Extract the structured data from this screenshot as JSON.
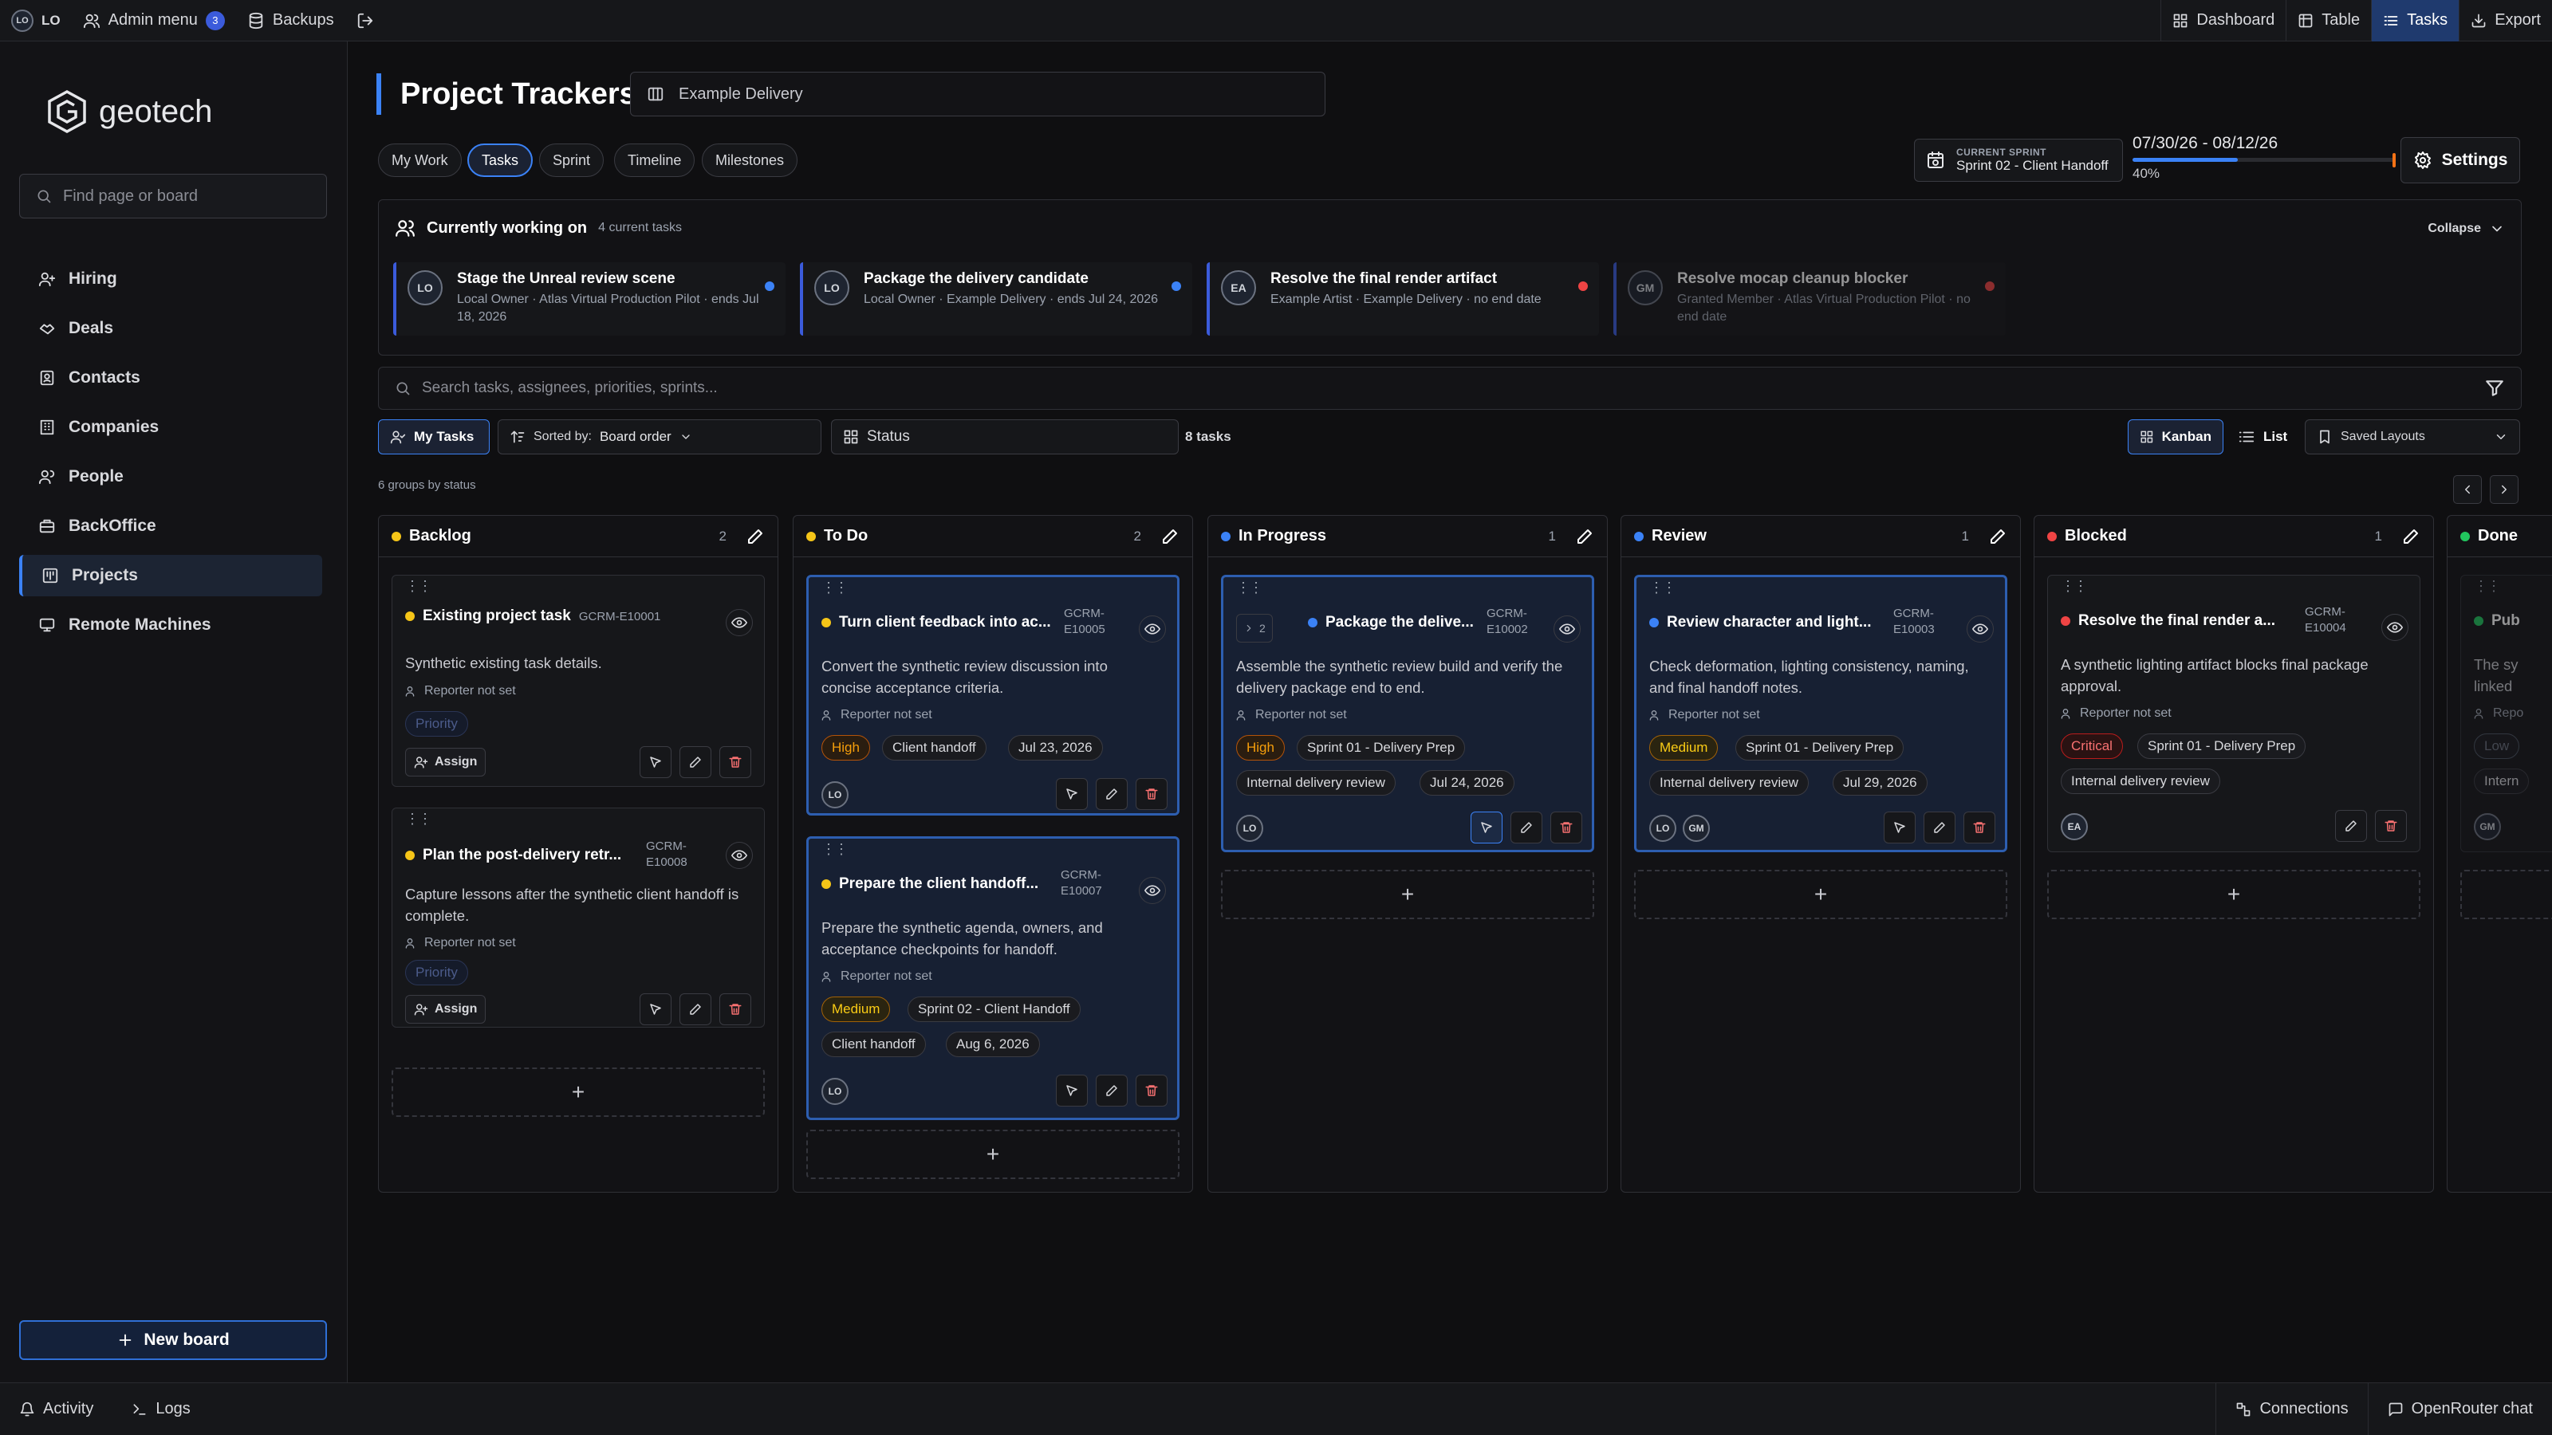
{
  "topbar": {
    "user_initials": "LO",
    "user_label": "LO",
    "admin_menu": "Admin menu",
    "admin_badge": "3",
    "backups": "Backups",
    "views": [
      {
        "label": "Dashboard",
        "icon": "dashboard-icon"
      },
      {
        "label": "Table",
        "icon": "table-icon"
      },
      {
        "label": "Tasks",
        "icon": "tasks-icon",
        "active": true
      },
      {
        "label": "Export",
        "icon": "download-icon"
      }
    ]
  },
  "sidebar": {
    "brand": "geotech",
    "search_placeholder": "Find page or board",
    "items": [
      {
        "label": "Hiring"
      },
      {
        "label": "Deals"
      },
      {
        "label": "Contacts"
      },
      {
        "label": "Companies"
      },
      {
        "label": "People"
      },
      {
        "label": "BackOffice"
      },
      {
        "label": "Projects",
        "active": true
      },
      {
        "label": "Remote Machines"
      }
    ],
    "new_board": "New board"
  },
  "bottombar": {
    "activity": "Activity",
    "logs": "Logs",
    "connections": "Connections",
    "chat": "OpenRouter chat"
  },
  "page": {
    "title": "Project Trackers",
    "board": "Example Delivery",
    "tabs": [
      "My Work",
      "Tasks",
      "Sprint",
      "Timeline",
      "Milestones"
    ],
    "active_tab": "Tasks"
  },
  "sprint": {
    "label": "CURRENT SPRINT",
    "name": "Sprint 02 - Client Handoff",
    "range": "07/30/26 - 08/12/26",
    "progress_pct": 40,
    "progress_label": "40%",
    "settings": "Settings"
  },
  "current": {
    "heading": "Currently working on",
    "count": "4 current tasks",
    "collapse": "Collapse",
    "cards": [
      {
        "initials": "LO",
        "title": "Stage the Unreal review scene",
        "sub": "Local Owner · Atlas Virtual Production Pilot · ends Jul 18, 2026",
        "dot": "#3b82f6"
      },
      {
        "initials": "LO",
        "title": "Package the delivery candidate",
        "sub": "Local Owner · Example Delivery · ends Jul 24, 2026",
        "dot": "#3b82f6"
      },
      {
        "initials": "EA",
        "title": "Resolve the final render artifact",
        "sub": "Example Artist · Example Delivery · no end date",
        "dot": "#ef4444"
      },
      {
        "initials": "GM",
        "title": "Resolve mocap cleanup blocker",
        "sub": "Granted Member · Atlas Virtual Production Pilot · no end date",
        "dot": "#ef4444"
      }
    ]
  },
  "toolbar": {
    "search_placeholder": "Search tasks, assignees, priorities, sprints...",
    "my_tasks": "My Tasks",
    "sorted_by_label": "Sorted by:",
    "sorted_by_value": "Board order",
    "group": "Status",
    "task_count": "8 tasks",
    "kanban": "Kanban",
    "list": "List",
    "saved_layouts": "Saved Layouts",
    "groups_note": "6 groups by status"
  },
  "columns": [
    {
      "name": "Backlog",
      "count": "2",
      "color": "#f5c518"
    },
    {
      "name": "To Do",
      "count": "2",
      "color": "#f5c518"
    },
    {
      "name": "In Progress",
      "count": "1",
      "color": "#3b82f6"
    },
    {
      "name": "Review",
      "count": "1",
      "color": "#3b82f6"
    },
    {
      "name": "Blocked",
      "count": "1",
      "color": "#ef4444"
    },
    {
      "name": "Done",
      "count": "",
      "color": "#22c55e"
    }
  ],
  "cards": {
    "b1": {
      "title": "Existing project task",
      "id": "GCRM-E10001",
      "desc": "Synthetic existing task details.",
      "reporter": "Reporter not set",
      "tag": "Priority",
      "assign": "Assign"
    },
    "b2": {
      "title": "Plan the post-delivery retr...",
      "id1": "GCRM-",
      "id2": "E10008",
      "desc": "Capture lessons after the synthetic client handoff is complete.",
      "reporter": "Reporter not set",
      "tag": "Priority",
      "assign": "Assign"
    },
    "t1": {
      "title": "Turn client feedback into ac...",
      "id1": "GCRM-",
      "id2": "E10005",
      "desc": "Convert the synthetic review discussion into concise acceptance criteria.",
      "reporter": "Reporter not set",
      "priority": "High",
      "tag2": "Client handoff",
      "date": "Jul 23, 2026",
      "av": "LO"
    },
    "t2": {
      "title": "Prepare the client handoff...",
      "id1": "GCRM-",
      "id2": "E10007",
      "desc": "Prepare the synthetic agenda, owners, and acceptance checkpoints for handoff.",
      "reporter": "Reporter not set",
      "priority": "Medium",
      "sprint": "Sprint 02 - Client Handoff",
      "tag2": "Client handoff",
      "date": "Aug 6, 2026",
      "av": "LO"
    },
    "p1": {
      "subcount": "2",
      "title": "Package the delive...",
      "id1": "GCRM-",
      "id2": "E10002",
      "desc": "Assemble the synthetic review build and verify the delivery package end to end.",
      "reporter": "Reporter not set",
      "priority": "High",
      "sprint": "Sprint 01 - Delivery Prep",
      "tag2": "Internal delivery review",
      "date": "Jul 24, 2026",
      "av": "LO"
    },
    "r1": {
      "title": "Review character and light...",
      "id1": "GCRM-",
      "id2": "E10003",
      "desc": "Check deformation, lighting consistency, naming, and final handoff notes.",
      "reporter": "Reporter not set",
      "priority": "Medium",
      "sprint": "Sprint 01 - Delivery Prep",
      "tag2": "Internal delivery review",
      "date": "Jul 29, 2026",
      "av1": "LO",
      "av2": "GM"
    },
    "k1": {
      "title": "Resolve the final render a...",
      "id1": "GCRM-",
      "id2": "E10004",
      "desc": "A synthetic lighting artifact blocks final package approval.",
      "reporter": "Reporter not set",
      "priority": "Critical",
      "sprint": "Sprint 01 - Delivery Prep",
      "tag2": "Internal delivery review",
      "av": "EA"
    },
    "d1": {
      "title": "Pub",
      "desc1": "The sy",
      "desc2": "linked",
      "reporter": "Repo",
      "priority": "Low",
      "tag2": "Intern",
      "av": "GM"
    }
  }
}
